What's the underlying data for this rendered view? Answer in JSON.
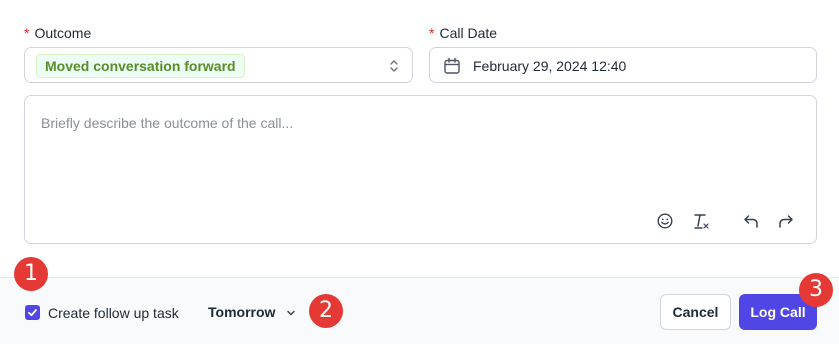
{
  "outcome": {
    "label": "Outcome",
    "required_mark": "*",
    "value": "Moved conversation forward"
  },
  "call_date": {
    "label": "Call Date",
    "required_mark": "*",
    "value": "February 29, 2024 12:40"
  },
  "description": {
    "placeholder": "Briefly describe the outcome of the call...",
    "toolbar": [
      "emoji-icon",
      "clear-format-icon",
      "undo-icon",
      "redo-icon"
    ]
  },
  "footer": {
    "follow_up_checked": true,
    "follow_up_label": "Create follow up task",
    "due_label": "Tomorrow",
    "cancel_label": "Cancel",
    "log_call_label": "Log Call"
  },
  "markers": [
    "1",
    "2",
    "3"
  ],
  "colors": {
    "primary": "#5046e5",
    "required": "#dc2626",
    "pill_bg": "#ecfdf3",
    "pill_text": "#5a8c2a",
    "marker": "#e53935"
  }
}
